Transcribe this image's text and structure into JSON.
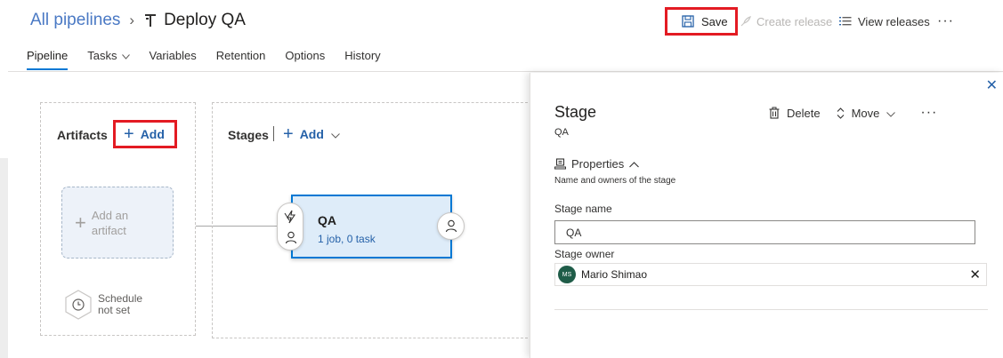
{
  "breadcrumb": {
    "root": "All pipelines",
    "separator": "›",
    "title": "Deploy QA"
  },
  "toolbar": {
    "save_label": "Save",
    "create_release_label": "Create release",
    "view_releases_label": "View releases",
    "more_label": "···"
  },
  "tabs": [
    {
      "label": "Pipeline",
      "active": true
    },
    {
      "label": "Tasks",
      "has_dropdown": true
    },
    {
      "label": "Variables"
    },
    {
      "label": "Retention"
    },
    {
      "label": "Options"
    },
    {
      "label": "History"
    }
  ],
  "artifacts": {
    "title": "Artifacts",
    "add_label": "Add",
    "placeholder_line1": "Add an",
    "placeholder_line2": "artifact",
    "schedule_line1": "Schedule",
    "schedule_line2": "not set"
  },
  "stages": {
    "title": "Stages",
    "add_label": "Add",
    "stage_card": {
      "name": "QA",
      "summary": "1 job, 0 task"
    }
  },
  "panel": {
    "title": "Stage",
    "subtitle": "QA",
    "delete_label": "Delete",
    "move_label": "Move",
    "more_label": "···",
    "properties_label": "Properties",
    "properties_desc": "Name and owners of the stage",
    "stage_name_label": "Stage name",
    "stage_name_value": "QA",
    "stage_owner_label": "Stage owner",
    "owner_initials": "MS",
    "owner_name": "Mario Shimao",
    "close_label": "✕",
    "clear_label": "✕"
  },
  "colors": {
    "accent": "#0078d4",
    "highlight": "#e31b23",
    "link": "#2561a8",
    "avatar": "#1f5c48"
  }
}
